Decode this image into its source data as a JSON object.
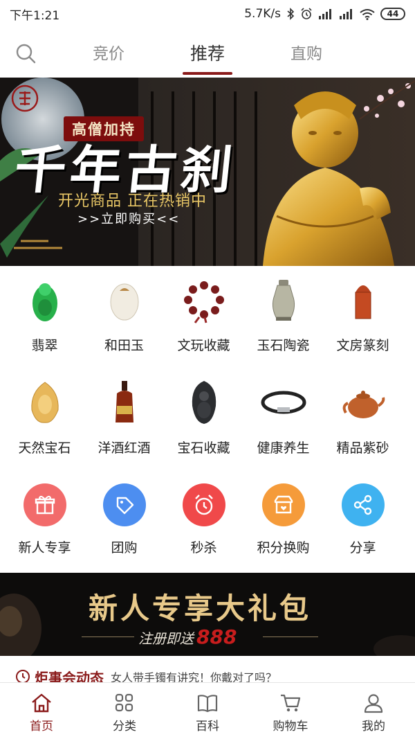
{
  "status_bar": {
    "time": "下午1:21",
    "network_speed": "5.7K/s",
    "battery": "44"
  },
  "top_nav": {
    "search_icon": "search-icon",
    "tabs": [
      {
        "label": "竞价",
        "active": false
      },
      {
        "label": "推荐",
        "active": true
      },
      {
        "label": "直购",
        "active": false
      }
    ]
  },
  "banner": {
    "tag": "高僧加持",
    "title": "千年古刹",
    "subtitle": "开光商品 正在热销中",
    "cta": ">>立即购买<<"
  },
  "categories": {
    "row1": [
      {
        "label": "翡翠",
        "icon": "jade-guanyin-icon"
      },
      {
        "label": "和田玉",
        "icon": "white-jade-icon"
      },
      {
        "label": "文玩收藏",
        "icon": "bead-bracelet-icon"
      },
      {
        "label": "玉石陶瓷",
        "icon": "ceramic-vase-icon"
      },
      {
        "label": "文房篆刻",
        "icon": "seal-stamp-icon"
      }
    ],
    "row2": [
      {
        "label": "天然宝石",
        "icon": "amber-gem-icon"
      },
      {
        "label": "洋酒红酒",
        "icon": "liquor-bottle-icon"
      },
      {
        "label": "宝石收藏",
        "icon": "obsidian-pendant-icon"
      },
      {
        "label": "健康养生",
        "icon": "wristband-icon"
      },
      {
        "label": "精品紫砂",
        "icon": "teapot-icon"
      }
    ],
    "row3": [
      {
        "label": "新人专享",
        "icon": "gift-icon",
        "color": "#f26b6b"
      },
      {
        "label": "团购",
        "icon": "tag-icon",
        "color": "#4d8ef0"
      },
      {
        "label": "秒杀",
        "icon": "alarm-clock-icon",
        "color": "#f0494a"
      },
      {
        "label": "积分换购",
        "icon": "store-icon",
        "color": "#f59b3a"
      },
      {
        "label": "分享",
        "icon": "share-icon",
        "color": "#3fb2f0"
      }
    ]
  },
  "promo": {
    "title": "新人专享大礼包",
    "subtitle": "注册即送",
    "amount": "888"
  },
  "news": {
    "tag": "炬事会动态",
    "text": "女人带手镯有讲究！你戴对了吗？"
  },
  "bottom_nav": [
    {
      "label": "首页",
      "icon": "home-icon",
      "active": true
    },
    {
      "label": "分类",
      "icon": "grid-icon",
      "active": false
    },
    {
      "label": "百科",
      "icon": "book-icon",
      "active": false
    },
    {
      "label": "购物车",
      "icon": "cart-icon",
      "active": false
    },
    {
      "label": "我的",
      "icon": "user-icon",
      "active": false
    }
  ],
  "colors": {
    "accent": "#8a1a1a",
    "banner_gold": "#e9c766",
    "promo_gold": "#e8c98a",
    "promo_red": "#c81d1d"
  }
}
